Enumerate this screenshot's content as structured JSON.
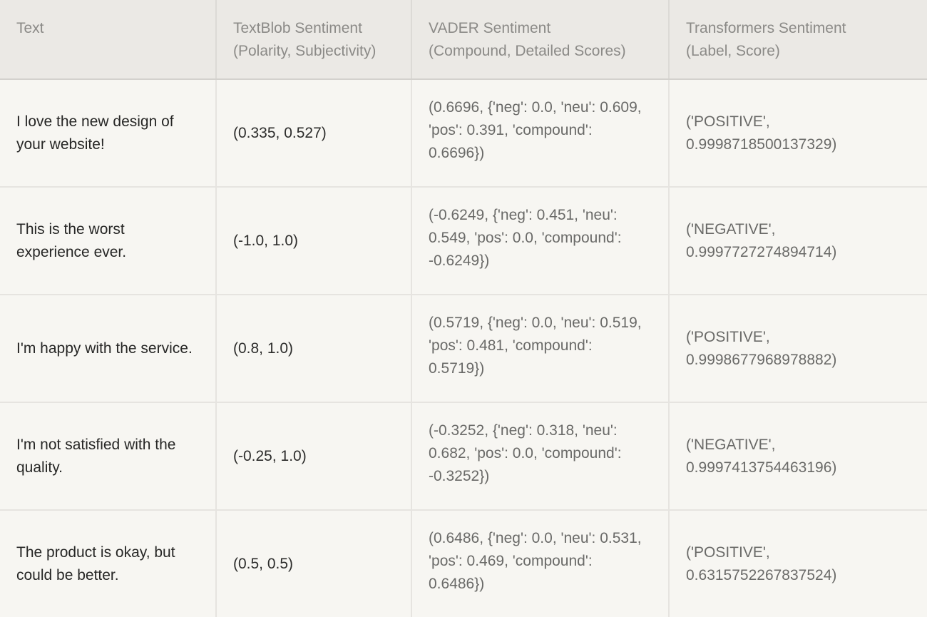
{
  "table": {
    "columns": [
      {
        "key": "text",
        "header_line1": "Text",
        "header_line2": ""
      },
      {
        "key": "textblob",
        "header_line1": "TextBlob Sentiment",
        "header_line2": "(Polarity, Subjectivity)"
      },
      {
        "key": "vader",
        "header_line1": "VADER Sentiment",
        "header_line2": "(Compound, Detailed Scores)"
      },
      {
        "key": "transformers",
        "header_line1": "Transformers Sentiment",
        "header_line2": "(Label, Score)"
      }
    ],
    "rows": [
      {
        "text": "I love the new design of your website!",
        "textblob": "(0.335, 0.527)",
        "vader": "(0.6696, {'neg': 0.0, 'neu': 0.609, 'pos': 0.391, 'compound': 0.6696})",
        "transformers_label": "('POSITIVE',",
        "transformers_score": "0.9998718500137329)"
      },
      {
        "text": "This is the worst experience ever.",
        "textblob": "(-1.0, 1.0)",
        "vader": "(-0.6249, {'neg': 0.451, 'neu': 0.549, 'pos': 0.0, 'compound': -0.6249})",
        "transformers_label": "('NEGATIVE',",
        "transformers_score": "0.9997727274894714)"
      },
      {
        "text": "I'm happy with the service.",
        "textblob": "(0.8, 1.0)",
        "vader": "(0.5719, {'neg': 0.0, 'neu': 0.519, 'pos': 0.481, 'compound': 0.5719})",
        "transformers_label": "('POSITIVE',",
        "transformers_score": "0.9998677968978882)"
      },
      {
        "text": "I'm not satisfied with the quality.",
        "textblob": "(-0.25, 1.0)",
        "vader": "(-0.3252, {'neg': 0.318, 'neu': 0.682, 'pos': 0.0, 'compound': -0.3252})",
        "transformers_label": "('NEGATIVE',",
        "transformers_score": "0.9997413754463196)"
      },
      {
        "text": "The product is okay, but could be better.",
        "textblob": "(0.5, 0.5)",
        "vader": "(0.6486, {'neg': 0.0, 'neu': 0.531, 'pos': 0.469, 'compound': 0.6486})",
        "transformers_label": "('POSITIVE',",
        "transformers_score": "0.6315752267837524)"
      }
    ]
  },
  "colors": {
    "header_background": "#ebe9e5",
    "header_text": "#8b8a87",
    "body_background": "#f7f6f2",
    "primary_text": "#2c2c2b",
    "secondary_text": "#6a6a68",
    "grid_line": "#e6e4e0"
  }
}
